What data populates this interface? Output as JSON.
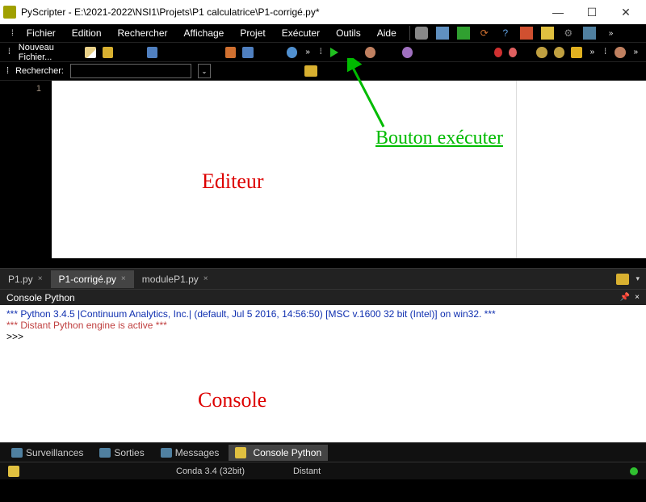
{
  "title": "PyScripter - E:\\2021-2022\\NSI1\\Projets\\P1 calculatrice\\P1-corrigé.py*",
  "menu": [
    "Fichier",
    "Edition",
    "Rechercher",
    "Affichage",
    "Projet",
    "Exécuter",
    "Outils",
    "Aide"
  ],
  "toolbar1": {
    "new_file": "Nouveau Fichier..."
  },
  "search": {
    "label": "Rechercher:",
    "value": ""
  },
  "editor": {
    "line_numbers": [
      "1"
    ]
  },
  "tabs": {
    "items": [
      {
        "label": "P1.py",
        "close": "×"
      },
      {
        "label": "P1-corrigé.py",
        "close": "×",
        "active": true
      },
      {
        "label": "moduleP1.py",
        "close": "×"
      }
    ]
  },
  "console_header": "Console Python",
  "console": {
    "line1": "*** Python 3.4.5 |Continuum Analytics, Inc.| (default, Jul  5 2016, 14:56:50) [MSC v.1600 32 bit (Intel)] on win32. ***",
    "line2": "*** Distant Python engine is active ***",
    "prompt": ">>>"
  },
  "bottom_tabs": [
    "Surveillances",
    "Sorties",
    "Messages",
    "Console Python"
  ],
  "statusbar": {
    "conda": "Conda 3.4 (32bit)",
    "engine": "Distant"
  },
  "annotations": {
    "editor": "Editeur",
    "run": "Bouton exécuter",
    "console": "Console"
  }
}
